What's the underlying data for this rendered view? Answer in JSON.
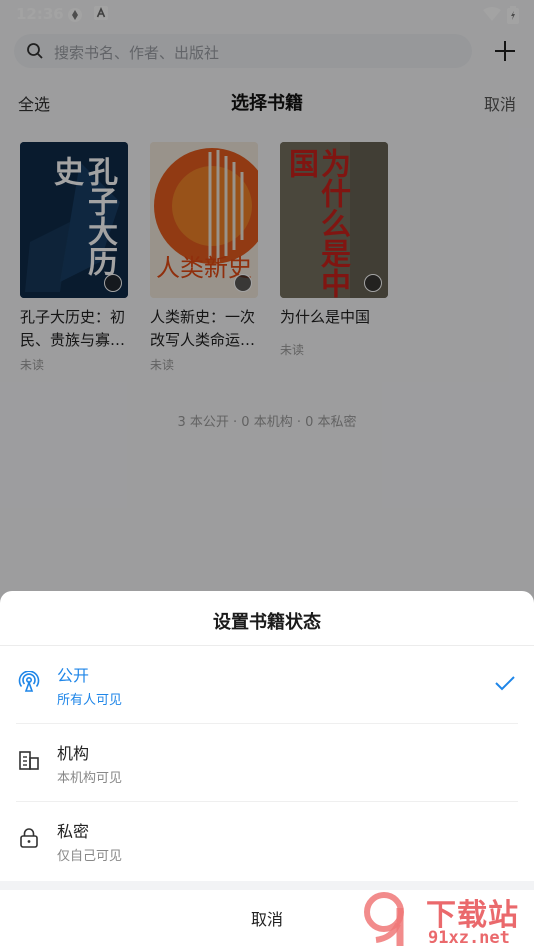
{
  "status_bar": {
    "time": "12:36"
  },
  "search": {
    "placeholder": "搜索书名、作者、出版社"
  },
  "header": {
    "select_all": "全选",
    "title": "选择书籍",
    "cancel": "取消"
  },
  "books": [
    {
      "title": "孔子大历史：初民、贵族与寡…",
      "status": "未读",
      "cover_text": "孔子大历史"
    },
    {
      "title": "人类新史：一次改写人类命运…",
      "status": "未读",
      "cover_text": "人类新史"
    },
    {
      "title": "为什么是中国",
      "status": "未读",
      "cover_text": "为什么是中国"
    }
  ],
  "summary": "3 本公开 · 0 本机构 · 0 本私密",
  "sheet": {
    "title": "设置书籍状态",
    "options": [
      {
        "label": "公开",
        "sub": "所有人可见",
        "selected": true,
        "icon": "broadcast-icon"
      },
      {
        "label": "机构",
        "sub": "本机构可见",
        "selected": false,
        "icon": "building-icon"
      },
      {
        "label": "私密",
        "sub": "仅自己可见",
        "selected": false,
        "icon": "lock-icon"
      }
    ],
    "cancel": "取消"
  },
  "watermark": {
    "text_top": "下载站",
    "text_bottom": "91xz.net"
  },
  "colors": {
    "accent": "#1f86e8",
    "overlay": "rgba(0,0,0,0.36)"
  }
}
